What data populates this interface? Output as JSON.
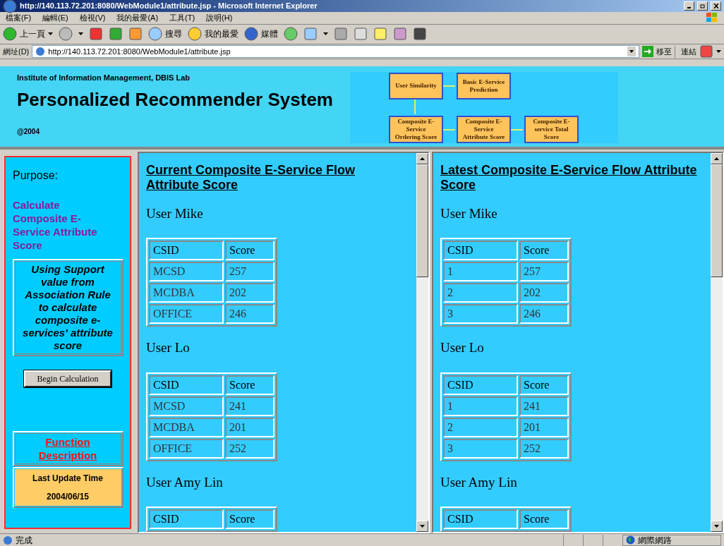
{
  "window": {
    "title": "http://140.113.72.201:8080/WebModule1/attribute.jsp - Microsoft Internet Explorer"
  },
  "menu": [
    "檔案(F)",
    "編輯(E)",
    "檢視(V)",
    "我的最愛(A)",
    "工具(T)",
    "說明(H)"
  ],
  "toolbar": [
    {
      "label": "上一頁"
    },
    {
      "label": "搜尋"
    },
    {
      "label": "我的最愛"
    },
    {
      "label": "媒體"
    }
  ],
  "address_bar": {
    "label": "網址(D)",
    "url": "http://140.113.72.201:8080/WebModule1/attribute.jsp",
    "go": "移至",
    "links": "連結"
  },
  "header": {
    "lab": "Institute of Information Management, DBIS Lab",
    "title": "Personalized Recommender System",
    "year": "@2004",
    "diagram": [
      "User Similarity",
      "Basic E-Service Prediction",
      "Composite E-Service Ordering Score",
      "Composite E-Service Attribute Score",
      "Composite E-service Total Score"
    ]
  },
  "sidebar": {
    "purpose_label": "Purpose:",
    "purpose": "Calculate Composite E-Service Attribute Score",
    "note": "Using Support value from Association Rule to calculate composite e-services' attribute score",
    "button": "Begin Calculation",
    "link": "Function Description",
    "update_label": "Last Update Time",
    "update_date": "2004/06/15"
  },
  "frames": [
    {
      "title": "Current Composite E-Service Flow Attribute Score",
      "users": [
        {
          "name": "User Mike",
          "columns": [
            "CSID",
            "Score"
          ],
          "rows": [
            [
              "MCSD",
              "257"
            ],
            [
              "MCDBA",
              "202"
            ],
            [
              "OFFICE",
              "246"
            ]
          ]
        },
        {
          "name": "User Lo",
          "columns": [
            "CSID",
            "Score"
          ],
          "rows": [
            [
              "MCSD",
              "241"
            ],
            [
              "MCDBA",
              "201"
            ],
            [
              "OFFICE",
              "252"
            ]
          ]
        },
        {
          "name": "User Amy Lin",
          "columns": [
            "CSID",
            "Score"
          ]
        }
      ]
    },
    {
      "title": "Latest Composite E-Service Flow Attribute Score",
      "users": [
        {
          "name": "User Mike",
          "columns": [
            "CSID",
            "Score"
          ],
          "rows": [
            [
              "1",
              "257"
            ],
            [
              "2",
              "202"
            ],
            [
              "3",
              "246"
            ]
          ]
        },
        {
          "name": "User Lo",
          "columns": [
            "CSID",
            "Score"
          ],
          "rows": [
            [
              "1",
              "241"
            ],
            [
              "2",
              "201"
            ],
            [
              "3",
              "252"
            ]
          ]
        },
        {
          "name": "User Amy Lin",
          "columns": [
            "CSID",
            "Score"
          ]
        }
      ]
    }
  ],
  "status_bar": {
    "text": "完成",
    "zone": "網際網路"
  }
}
